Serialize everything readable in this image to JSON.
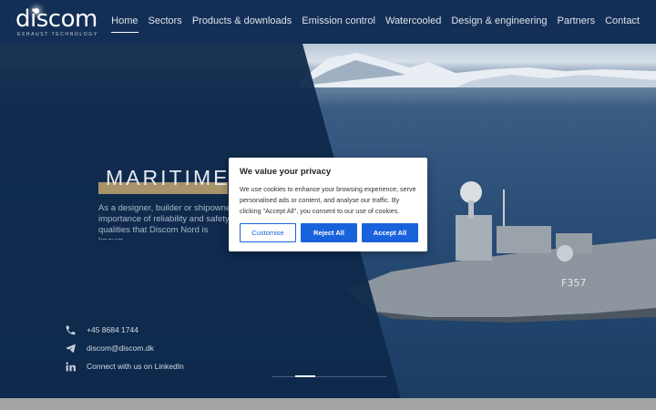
{
  "brand": {
    "name": "discom",
    "tagline": "EXHAUST TECHNOLOGY"
  },
  "nav": [
    {
      "label": "Home",
      "active": true
    },
    {
      "label": "Sectors"
    },
    {
      "label": "Products & downloads"
    },
    {
      "label": "Emission control"
    },
    {
      "label": "Watercooled"
    },
    {
      "label": "Design & engineering"
    },
    {
      "label": "Partners"
    },
    {
      "label": "Contact"
    }
  ],
  "hero": {
    "title": "MARITIME",
    "text": "As a designer, builder or shipowner importance of reliability and safety qualities that Discom Nord is known",
    "ship_marking": "F357"
  },
  "contacts": {
    "phone": "+45 8684 1744",
    "email": "discom@discom.dk",
    "linkedin": "Connect with us on LinkedIn"
  },
  "cookie": {
    "title": "We value your privacy",
    "text": "We use cookies to enhance your browsing experience, serve personalised ads or content, and analyse our traffic. By clicking \"Accept All\", you consent to our use of cookies.",
    "customise": "Customise",
    "reject": "Reject All",
    "accept": "Accept All"
  },
  "colors": {
    "primary_bg": "#0f2a4c",
    "accent": "#a7946a",
    "button": "#1863dc"
  },
  "icons": {
    "phone": "phone-icon",
    "email": "paper-plane-icon",
    "linkedin": "linkedin-icon"
  }
}
